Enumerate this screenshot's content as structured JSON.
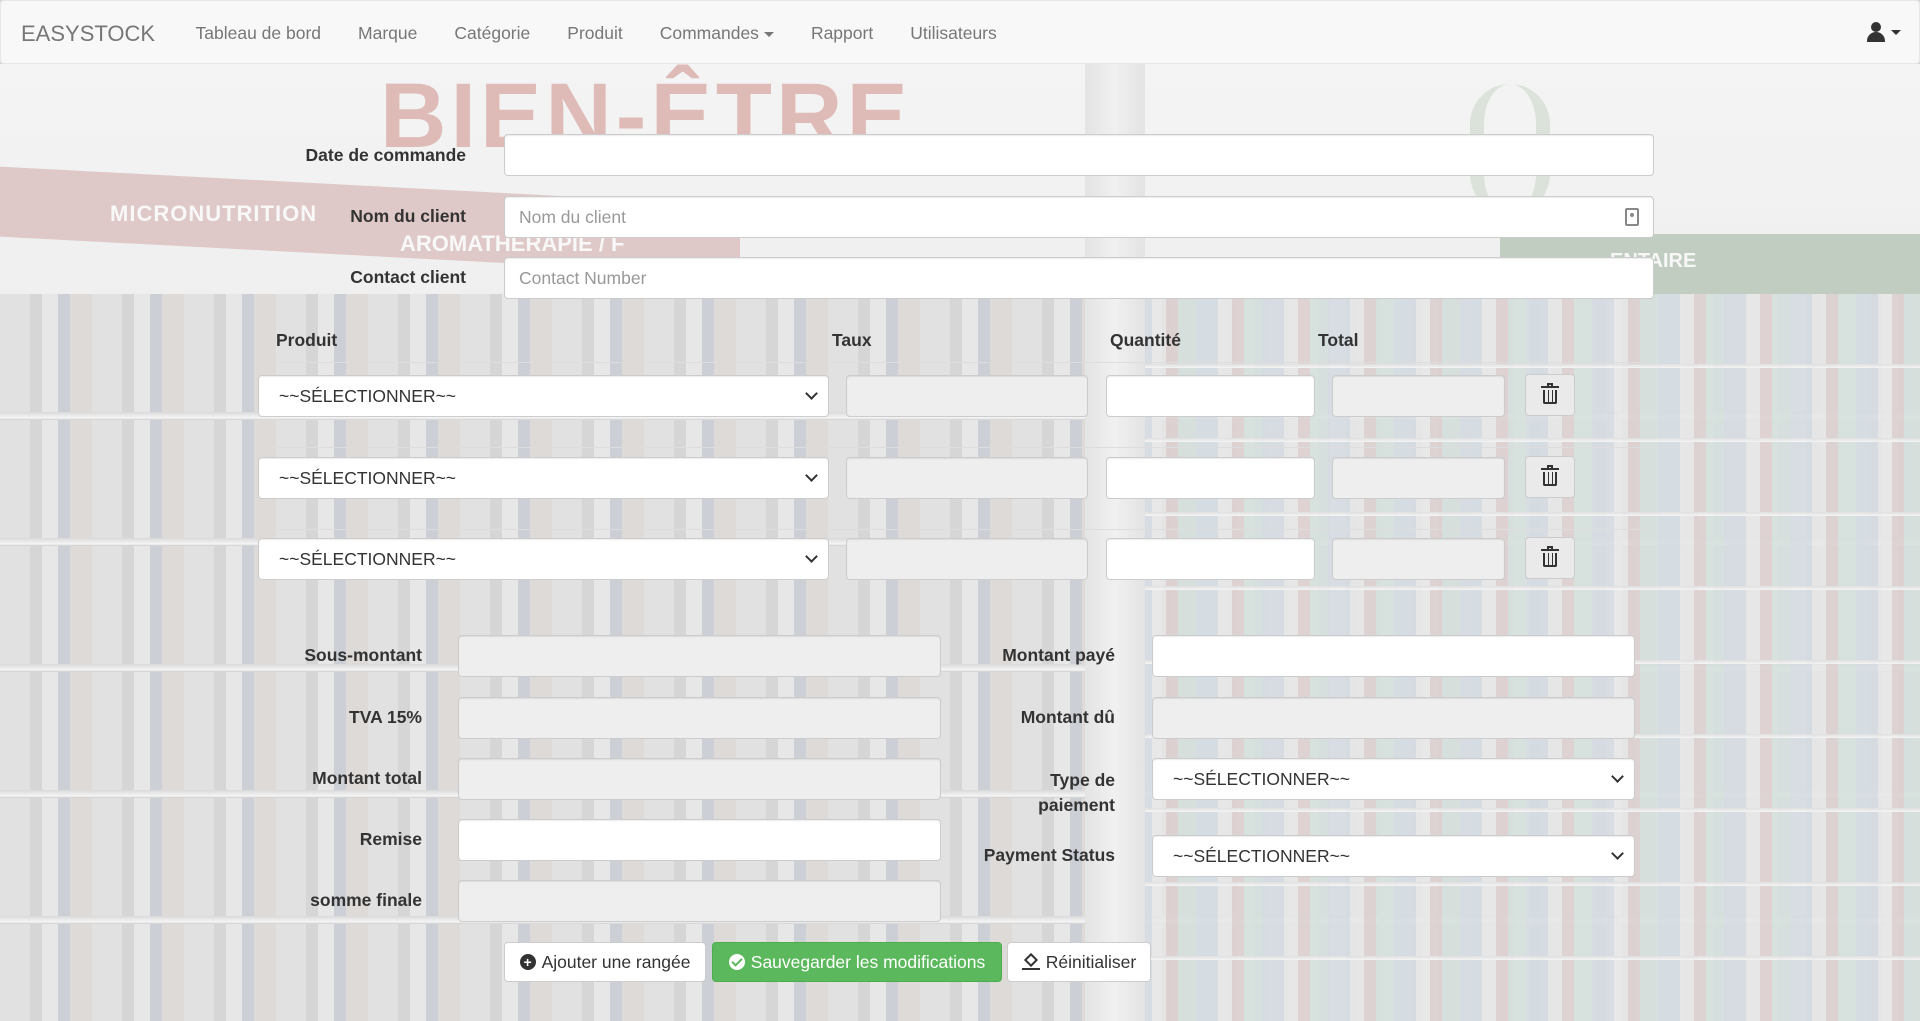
{
  "navbar": {
    "brand": "EASYSTOCK",
    "items": [
      {
        "label": "Tableau de bord"
      },
      {
        "label": "Marque"
      },
      {
        "label": "Catégorie"
      },
      {
        "label": "Produit"
      },
      {
        "label": "Commandes"
      },
      {
        "label": "Rapport"
      },
      {
        "label": "Utilisateurs"
      }
    ],
    "user_icon": "user-icon"
  },
  "background": {
    "sign": "BIEN-ÊTRE",
    "band1": "MICRONUTRITION",
    "band2": "AROMATHERAPIE / F",
    "band3": "ENTAIRE"
  },
  "order": {
    "date_label": "Date de commande",
    "date_value": "",
    "client_name_label": "Nom du client",
    "client_name_placeholder": "Nom du client",
    "contact_label": "Contact client",
    "contact_placeholder": "Contact Number"
  },
  "table": {
    "headers": {
      "product": "Produit",
      "rate": "Taux",
      "quantity": "Quantité",
      "total": "Total"
    },
    "rows": [
      {
        "product": "~~SÉLECTIONNER~~",
        "rate": "",
        "quantity": "",
        "total": ""
      },
      {
        "product": "~~SÉLECTIONNER~~",
        "rate": "",
        "quantity": "",
        "total": ""
      },
      {
        "product": "~~SÉLECTIONNER~~",
        "rate": "",
        "quantity": "",
        "total": ""
      }
    ]
  },
  "summary": {
    "subtotal_label": "Sous-montant",
    "vat_label": "TVA 15%",
    "total_label": "Montant total",
    "discount_label": "Remise",
    "final_label": "somme finale",
    "paid_label": "Montant payé",
    "due_label": "Montant dû",
    "payment_type_label_1": "Type de",
    "payment_type_label_2": "paiement",
    "payment_type_value": "~~SÉLECTIONNER~~",
    "payment_status_label": "Payment Status",
    "payment_status_value": "~~SÉLECTIONNER~~"
  },
  "actions": {
    "add_row": "Ajouter une rangée",
    "save": "Sauvegarder les modifications",
    "reset": "Réinitialiser"
  },
  "colors": {
    "success": "#5cb85c",
    "readonly": "#eeeeee",
    "navbar": "#f8f8f8"
  }
}
